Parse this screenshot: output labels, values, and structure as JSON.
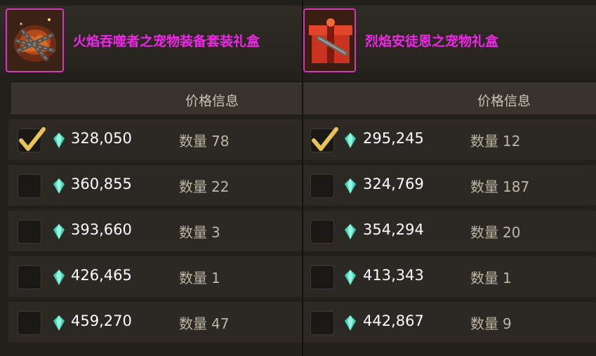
{
  "panels": [
    {
      "item_name": "火焰吞噬者之宠物装备套装礼盒",
      "column_title": "价格信息",
      "quantity_label": "数量",
      "rows": [
        {
          "price": "328,050",
          "quantity": "78",
          "selected": true
        },
        {
          "price": "360,855",
          "quantity": "22",
          "selected": false
        },
        {
          "price": "393,660",
          "quantity": "3",
          "selected": false
        },
        {
          "price": "426,465",
          "quantity": "1",
          "selected": false
        },
        {
          "price": "459,270",
          "quantity": "47",
          "selected": false
        }
      ]
    },
    {
      "item_name": "烈焰安徒恩之宠物礼盒",
      "column_title": "价格信息",
      "quantity_label": "数量",
      "rows": [
        {
          "price": "295,245",
          "quantity": "12",
          "selected": true
        },
        {
          "price": "324,769",
          "quantity": "187",
          "selected": false
        },
        {
          "price": "354,294",
          "quantity": "20",
          "selected": false
        },
        {
          "price": "413,343",
          "quantity": "1",
          "selected": false
        },
        {
          "price": "442,867",
          "quantity": "9",
          "selected": false
        }
      ]
    }
  ],
  "colors": {
    "item_name": "#ef26e8",
    "icon_border": "#d13bb9",
    "checkmark": "#e8c35a",
    "gem": "#3fd6b7"
  },
  "icons": {
    "item_left": "burning-chains-box-icon",
    "item_right": "red-gift-box-icon",
    "currency": "green-gem-icon",
    "check": "checkmark-icon"
  }
}
